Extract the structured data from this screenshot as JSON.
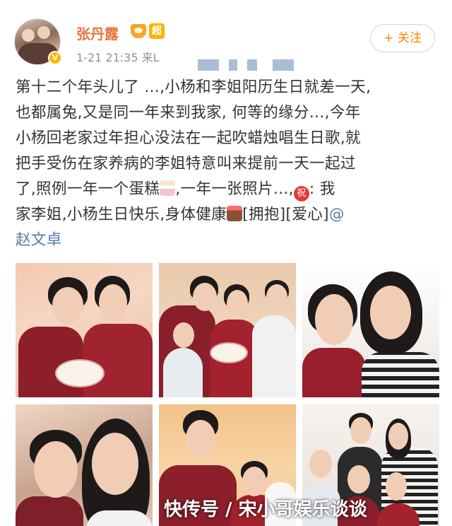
{
  "post": {
    "author": "张丹露",
    "member_badge": "超",
    "verified_badge": "V",
    "timestamp": "1-21 21:35  来L",
    "follow_label": "+ 关注",
    "text_line1": "第十二个年头儿了 ...,小杨和李姐阳历生日就差一天,",
    "text_line2": "也都属兔,又是同一年来到我家, 何等的缘分...,今年",
    "text_line3": "小杨回老家过年担心没法在一起吹蜡烛唱生日歌,就",
    "text_line4": "把手受伤在家养病的李姐特意叫来提前一天一起过",
    "text_line5a": "了,照例一年一个蛋糕",
    "text_line5b": ",一年一张照片...,",
    "emoji_zhu": "祝",
    "text_line5c": ": 我",
    "text_line6a": "家李姐,小杨生日快乐,身体健康",
    "text_line6b": "[拥抱][爱心]",
    "mention_at": "@",
    "mention_name": "赵文卓"
  },
  "icons": {
    "level": "crown-icon",
    "member": "member-badge-icon",
    "verified": "verified-icon",
    "cake": "cake-emoji-icon",
    "zhu": "zhu-emoji-icon"
  },
  "photos": [
    {
      "name": "photo-1"
    },
    {
      "name": "photo-2"
    },
    {
      "name": "photo-3"
    },
    {
      "name": "photo-4"
    },
    {
      "name": "photo-5"
    },
    {
      "name": "photo-6"
    }
  ],
  "watermark": "快传号 / 宋小哥娱乐谈谈",
  "colors": {
    "username": "#eb7340",
    "follow": "#ff8200",
    "mention": "#4f7cb0"
  }
}
